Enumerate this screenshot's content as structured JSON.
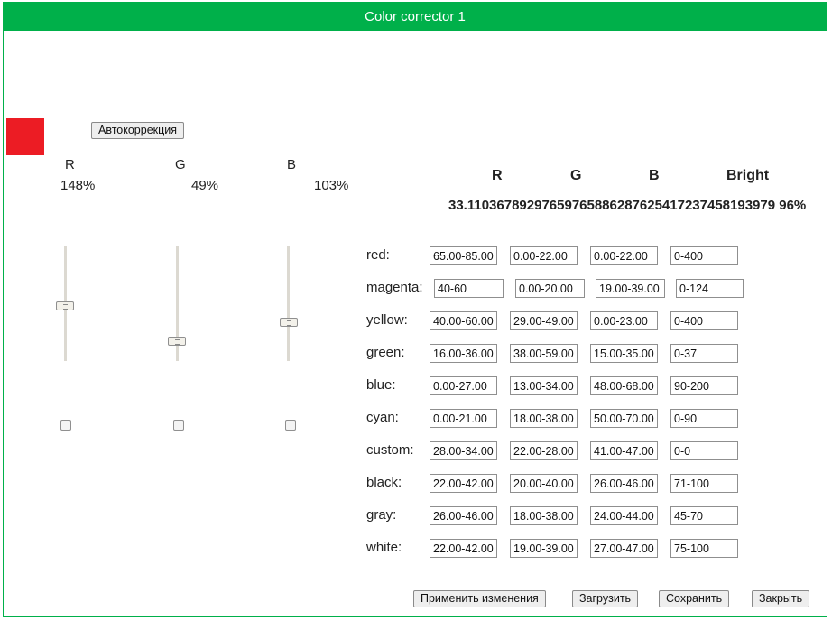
{
  "window": {
    "title": "Color corrector 1"
  },
  "swatch_color": "#ec1c24",
  "accent_color": "#00b04a",
  "autocorrect_label": "Автокоррекция",
  "channels": [
    {
      "label": "R",
      "percent": "148%",
      "checked": false
    },
    {
      "label": "G",
      "percent": "49%",
      "checked": false
    },
    {
      "label": "B",
      "percent": "103%",
      "checked": false
    }
  ],
  "stats": {
    "headers": [
      "R",
      "G",
      "B",
      "Bright"
    ],
    "values_line": "33.11036789297659765886287625417237458193979 96%"
  },
  "rows": [
    {
      "name": "red:",
      "r": "65.00-85.00",
      "g": "0.00-22.00",
      "b": "0.00-22.00",
      "bright": "0-400"
    },
    {
      "name": "magenta:",
      "r": "40-60",
      "g": "0.00-20.00",
      "b": "19.00-39.00",
      "bright": "0-124"
    },
    {
      "name": "yellow:",
      "r": "40.00-60.00",
      "g": "29.00-49.00",
      "b": "0.00-23.00",
      "bright": "0-400"
    },
    {
      "name": "green:",
      "r": "16.00-36.00",
      "g": "38.00-59.00",
      "b": "15.00-35.00",
      "bright": "0-37"
    },
    {
      "name": "blue:",
      "r": "0.00-27.00",
      "g": "13.00-34.00",
      "b": "48.00-68.00",
      "bright": "90-200"
    },
    {
      "name": "cyan:",
      "r": "0.00-21.00",
      "g": "18.00-38.00",
      "b": "50.00-70.00",
      "bright": "0-90"
    },
    {
      "name": "custom:",
      "r": "28.00-34.00",
      "g": "22.00-28.00",
      "b": "41.00-47.00",
      "bright": "0-0"
    },
    {
      "name": "black:",
      "r": "22.00-42.00",
      "g": "20.00-40.00",
      "b": "26.00-46.00",
      "bright": "71-100"
    },
    {
      "name": "gray:",
      "r": "26.00-46.00",
      "g": "18.00-38.00",
      "b": "24.00-44.00",
      "bright": "45-70"
    },
    {
      "name": "white:",
      "r": "22.00-42.00",
      "g": "19.00-39.00",
      "b": "27.00-47.00",
      "bright": "75-100"
    }
  ],
  "footer": {
    "apply": "Применить изменения",
    "load": "Загрузить",
    "save": "Сохранить",
    "close": "Закрыть"
  }
}
